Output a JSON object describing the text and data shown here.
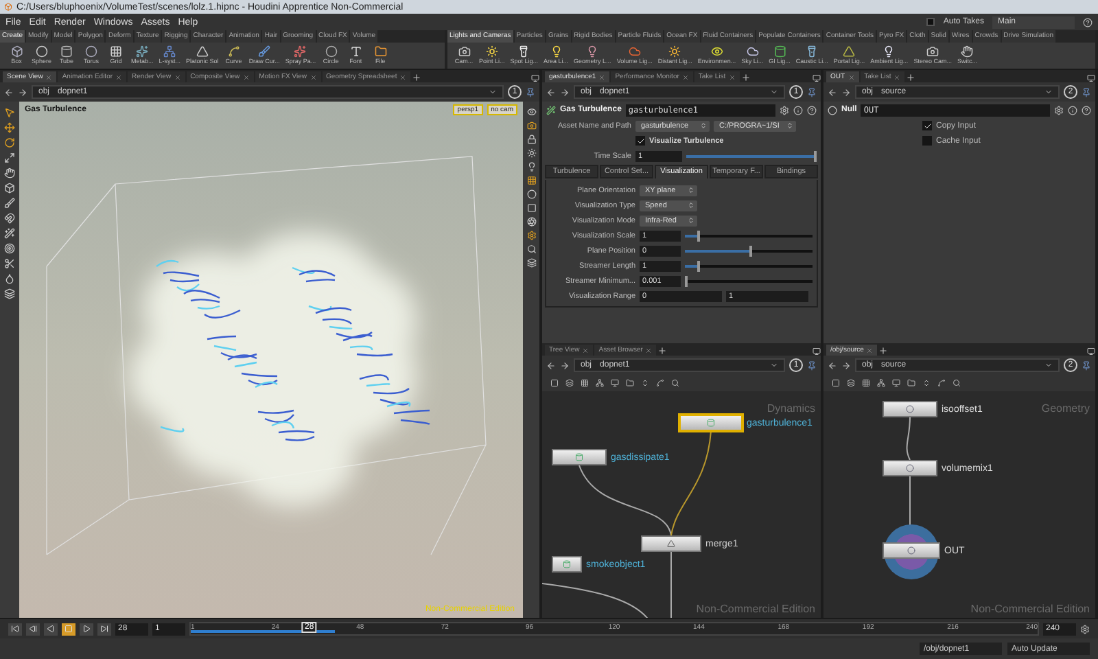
{
  "window": {
    "title": "C:/Users/bluphoenix/VolumeTest/scenes/lolz.1.hipnc - Houdini Apprentice Non-Commercial"
  },
  "menu": [
    "File",
    "Edit",
    "Render",
    "Windows",
    "Assets",
    "Help"
  ],
  "auto_takes": {
    "label": "Auto Takes",
    "checked": false
  },
  "desktop": "Main",
  "shelf_left": {
    "tabs": [
      {
        "label": "Create",
        "selected": true
      },
      {
        "label": "Modify",
        "selected": false
      },
      {
        "label": "Model",
        "selected": false
      },
      {
        "label": "Polygon",
        "selected": false
      },
      {
        "label": "Deform",
        "selected": false
      },
      {
        "label": "Texture",
        "selected": false
      },
      {
        "label": "Rigging",
        "selected": false
      },
      {
        "label": "Character",
        "selected": false
      },
      {
        "label": "Animation",
        "selected": false
      },
      {
        "label": "Hair",
        "selected": false
      },
      {
        "label": "Grooming",
        "selected": false
      },
      {
        "label": "Cloud FX",
        "selected": false
      },
      {
        "label": "Volume",
        "selected": false
      }
    ],
    "tools": [
      "Box",
      "Sphere",
      "Tube",
      "Torus",
      "Grid",
      "Metab...",
      "L-syst...",
      "Platonic Sol",
      "Curve",
      "Draw Cur...",
      "Spray Pa...",
      "Circle",
      "Font",
      "File"
    ]
  },
  "shelf_right": {
    "tabs": [
      {
        "label": "Lights and Cameras",
        "selected": true
      },
      {
        "label": "Particles",
        "selected": false
      },
      {
        "label": "Grains",
        "selected": false
      },
      {
        "label": "Rigid Bodies",
        "selected": false
      },
      {
        "label": "Particle Fluids",
        "selected": false
      },
      {
        "label": "Ocean FX",
        "selected": false
      },
      {
        "label": "Fluid Containers",
        "selected": false
      },
      {
        "label": "Populate Containers",
        "selected": false
      },
      {
        "label": "Container Tools",
        "selected": false
      },
      {
        "label": "Pyro FX",
        "selected": false
      },
      {
        "label": "Cloth",
        "selected": false
      },
      {
        "label": "Solid",
        "selected": false
      },
      {
        "label": "Wires",
        "selected": false
      },
      {
        "label": "Crowds",
        "selected": false
      },
      {
        "label": "Drive Simulation",
        "selected": false
      }
    ],
    "tools": [
      "Cam...",
      "Point Li...",
      "Spot Lig...",
      "Area Li...",
      "Geometry L...",
      "Volume Lig...",
      "Distant Lig...",
      "Environmen...",
      "Sky Li...",
      "GI Lig...",
      "Caustic Li...",
      "Portal Lig...",
      "Ambient Lig...",
      "Stereo Cam...",
      "Switc..."
    ]
  },
  "scene_pane": {
    "tabs": [
      {
        "label": "Scene View",
        "selected": true
      },
      {
        "label": "Animation Editor",
        "selected": false
      },
      {
        "label": "Render View",
        "selected": false
      },
      {
        "label": "Composite View",
        "selected": false
      },
      {
        "label": "Motion FX View",
        "selected": false
      },
      {
        "label": "Geometry Spreadsheet",
        "selected": false
      }
    ],
    "path": [
      "obj",
      "dopnet1"
    ],
    "link": "1",
    "viewport": {
      "title": "Gas Turbulence",
      "camera": "persp1",
      "view_camera": "no cam",
      "edition": "Non-Commercial Edition"
    }
  },
  "param_pane": {
    "tabs": [
      {
        "label": "gasturbulence1",
        "selected": true
      },
      {
        "label": "Performance Monitor",
        "selected": false
      },
      {
        "label": "Take List",
        "selected": false
      }
    ],
    "path": [
      "obj",
      "dopnet1"
    ],
    "link": "1",
    "node_type": "Gas Turbulence",
    "node_name": "gasturbulence1",
    "asset_label": "Asset Name and Path",
    "asset_name": "gasturbulence",
    "asset_path": "C:/PROGRA~1/SI",
    "visualize": {
      "label": "Visualize Turbulence",
      "checked": true
    },
    "time_scale": {
      "label": "Time Scale",
      "value": "1",
      "level": 1
    },
    "folders": [
      {
        "label": "Turbulence",
        "selected": false
      },
      {
        "label": "Control Set...",
        "selected": false
      },
      {
        "label": "Visualization",
        "selected": true
      },
      {
        "label": "Temporary F...",
        "selected": false
      },
      {
        "label": "Bindings",
        "selected": false
      }
    ],
    "rows": [
      {
        "kind": "menu",
        "label": "Plane Orientation",
        "value": "XY plane"
      },
      {
        "kind": "menu",
        "label": "Visualization Type",
        "value": "Speed"
      },
      {
        "kind": "menu",
        "label": "Visualization Mode",
        "value": "Infra-Red"
      },
      {
        "kind": "slider",
        "label": "Visualization Scale",
        "value": "1",
        "level": 0.1
      },
      {
        "kind": "slider",
        "label": "Plane Position",
        "value": "0",
        "level": 0.5
      },
      {
        "kind": "slider",
        "label": "Streamer Length",
        "value": "1",
        "level": 0.1
      },
      {
        "kind": "slider",
        "label": "Streamer Minimum...",
        "value": "0.001",
        "level": 0
      },
      {
        "kind": "pair",
        "label": "Visualization Range",
        "values": [
          "0",
          "1"
        ]
      }
    ]
  },
  "out_pane": {
    "tabs": [
      {
        "label": "OUT",
        "selected": true
      },
      {
        "label": "Take List",
        "selected": false
      }
    ],
    "path": [
      "obj",
      "source"
    ],
    "link": "2",
    "node_type": "Null",
    "node_name": "OUT",
    "options": [
      {
        "label": "Copy Input",
        "checked": true
      },
      {
        "label": "Cache Input",
        "checked": false
      }
    ]
  },
  "dop_network": {
    "tabs": [
      {
        "label": "Tree View",
        "selected": false
      },
      {
        "label": "Asset Browser",
        "selected": false
      }
    ],
    "path": [
      "obj",
      "dopnet1"
    ],
    "link": "1",
    "context": "Dynamics",
    "edition": "Non-Commercial Edition",
    "nodes": [
      {
        "name": "gasturbulence1",
        "kind": "solver",
        "selected": true
      },
      {
        "name": "gasdissipate1",
        "kind": "solver",
        "selected": false
      },
      {
        "name": "merge1",
        "kind": "merge",
        "selected": false
      },
      {
        "name": "smokeobject1",
        "kind": "solver",
        "selected": false
      }
    ]
  },
  "sop_network": {
    "tabs": [
      {
        "label": "/obj/source",
        "selected": true
      }
    ],
    "path": [
      "obj",
      "source"
    ],
    "link": "2",
    "context": "Geometry",
    "edition": "Non-Commercial Edition",
    "nodes": [
      {
        "name": "isooffset1",
        "kind": "sop",
        "selected": false
      },
      {
        "name": "volumemix1",
        "kind": "sop",
        "selected": false
      },
      {
        "name": "OUT",
        "kind": "null",
        "selected": true
      }
    ]
  },
  "timeline": {
    "transport": [
      {
        "kind": "first",
        "selected": false
      },
      {
        "kind": "step_back",
        "selected": false
      },
      {
        "kind": "reverse",
        "selected": false
      },
      {
        "kind": "stop",
        "selected": true
      },
      {
        "kind": "play",
        "selected": false
      },
      {
        "kind": "last",
        "selected": false
      }
    ],
    "frame": "28",
    "start": "1",
    "current": "28",
    "end": "240",
    "ticks": [
      "1",
      "24",
      "48",
      "72",
      "96",
      "120",
      "144",
      "168",
      "192",
      "216",
      "240"
    ]
  },
  "status": {
    "path": "/obj/dopnet1",
    "update": "Auto Update"
  }
}
